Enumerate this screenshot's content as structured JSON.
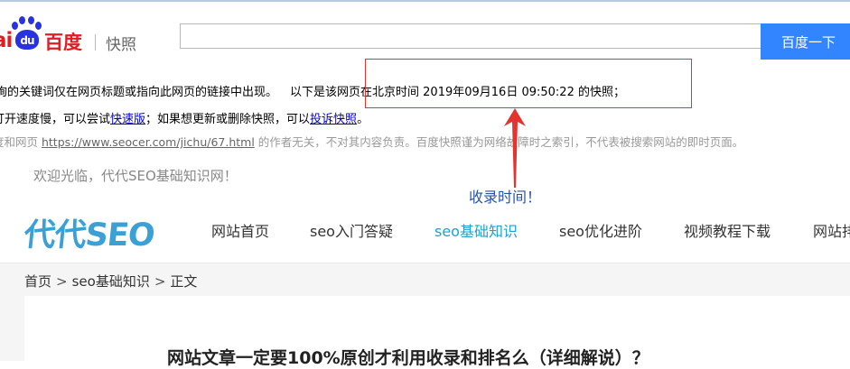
{
  "baidu": {
    "logo_bai": "ai",
    "logo_du": "du",
    "logo_name": "百度",
    "logo_sub": "快照",
    "search_value": "",
    "search_button": "百度一下",
    "notice_1_a": "查询的关键词仅在网页标题或指向此网页的链接中出现。",
    "notice_1_b": "以下是该网页在北京时间 2019年09月16日 09:50:22 的快照；",
    "notice_2_a": "打开速度慢，可以尝试",
    "notice_2_link": "快速版",
    "notice_2_b": "；如果想更新或删除快照，可以",
    "notice_2_link2": "投诉快照",
    "notice_2_c": "。",
    "notice_3_a": "度和网页 ",
    "notice_3_link": "https://www.seocer.com/jichu/67.html",
    "notice_3_b": " 的作者无关，不对其内容负责。百度快照谨为网络故障时之索引，不代表被搜索网站的即时页面。"
  },
  "annotation": {
    "label": "收录时间！",
    "color": "#e3342f"
  },
  "site": {
    "welcome": "欢迎光临，代代SEO基础知识网！",
    "logo": "代代SEO",
    "nav": [
      {
        "label": "网站首页",
        "active": false
      },
      {
        "label": "seo入门答疑",
        "active": false
      },
      {
        "label": "seo基础知识",
        "active": true
      },
      {
        "label": "seo优化进阶",
        "active": false
      },
      {
        "label": "视频教程下载",
        "active": false
      },
      {
        "label": "网站排名",
        "active": false
      }
    ],
    "breadcrumb": {
      "home": "首页",
      "category": "seo基础知识",
      "current": "正文",
      "separator": ">"
    },
    "article_title": "网站文章一定要100%原创才利用收录和排名么（详细解说）？",
    "accent_color": "#1aa1d6"
  }
}
